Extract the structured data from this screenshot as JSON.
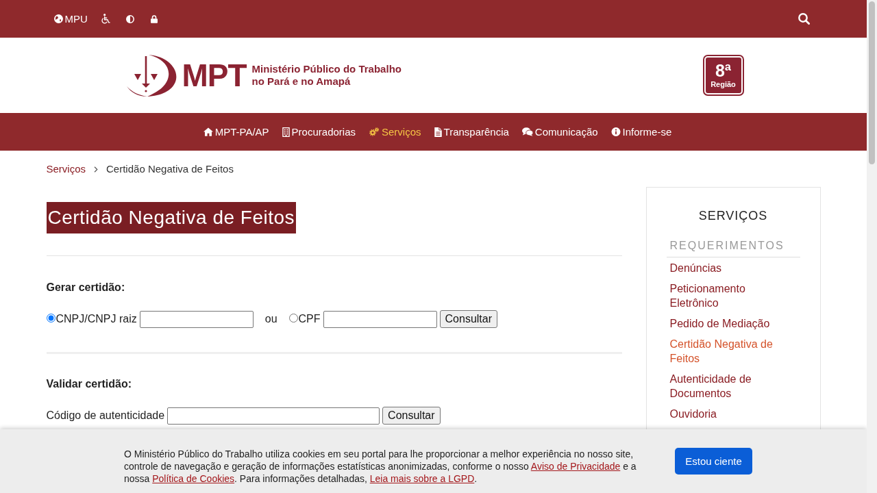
{
  "top_bar": {
    "portal_link": "MPU"
  },
  "header": {
    "logo": {
      "acronym": "MPT",
      "name_line_1": "Ministério Público do Trabalho",
      "name_line_2": "no Pará e no Amapá"
    },
    "region_badge": {
      "number": "8ª",
      "label": "Região"
    }
  },
  "nav": [
    {
      "label": "MPT-PA/AP",
      "selected": false
    },
    {
      "label": "Procuradorias",
      "selected": false
    },
    {
      "label": "Serviços",
      "selected": true
    },
    {
      "label": "Transparência",
      "selected": false
    },
    {
      "label": "Comunicação",
      "selected": false
    },
    {
      "label": "Informe-se",
      "selected": false
    }
  ],
  "breadcrumb": [
    {
      "label": "Serviços",
      "current": false
    },
    {
      "label": "Certidão Negativa de Feitos",
      "current": true
    }
  ],
  "page_title": "Certidão Negativa de Feitos",
  "generate_section": {
    "heading": "Gerar certidão:",
    "options": [
      {
        "label": "CNPJ/CNPJ raiz",
        "selected": true
      },
      {
        "label": "CPF",
        "selected": false
      }
    ],
    "separator": "ou",
    "button": "Consultar"
  },
  "validate_section": {
    "heading": "Validar certidão:",
    "field_label": "Código de autenticidade",
    "button": "Consultar"
  },
  "sidebar": {
    "title": "SERVIÇOS",
    "group": "REQUERIMENTOS",
    "items": [
      {
        "label": "Denúncias",
        "selected": false
      },
      {
        "label": "Peticionamento Eletrônico",
        "selected": false
      },
      {
        "label": "Pedido de Mediação",
        "selected": false
      },
      {
        "label": "Certidão Negativa de Feitos",
        "selected": true
      },
      {
        "label": "Autenticidade de Documentos",
        "selected": false
      },
      {
        "label": "Ouvidoria",
        "selected": false
      }
    ]
  },
  "cookie_banner": {
    "segments": [
      {
        "kind": "text",
        "text": "O Ministério Público do Trabalho utiliza cookies em seu portal para lhe proporcionar a melhor experiência no nosso site, controle de navegação e geração de informações estatísticas anonimizadas, conforme o nosso "
      },
      {
        "kind": "link",
        "text": "Aviso de Privacidade"
      },
      {
        "kind": "text",
        "text": " e a nossa "
      },
      {
        "kind": "link",
        "text": "Política de Cookies"
      },
      {
        "kind": "text",
        "text": ". Para informações detalhadas, "
      },
      {
        "kind": "link",
        "text": "Leia mais sobre a LGPD"
      },
      {
        "kind": "text",
        "text": "."
      }
    ],
    "button": "Estou ciente"
  }
}
